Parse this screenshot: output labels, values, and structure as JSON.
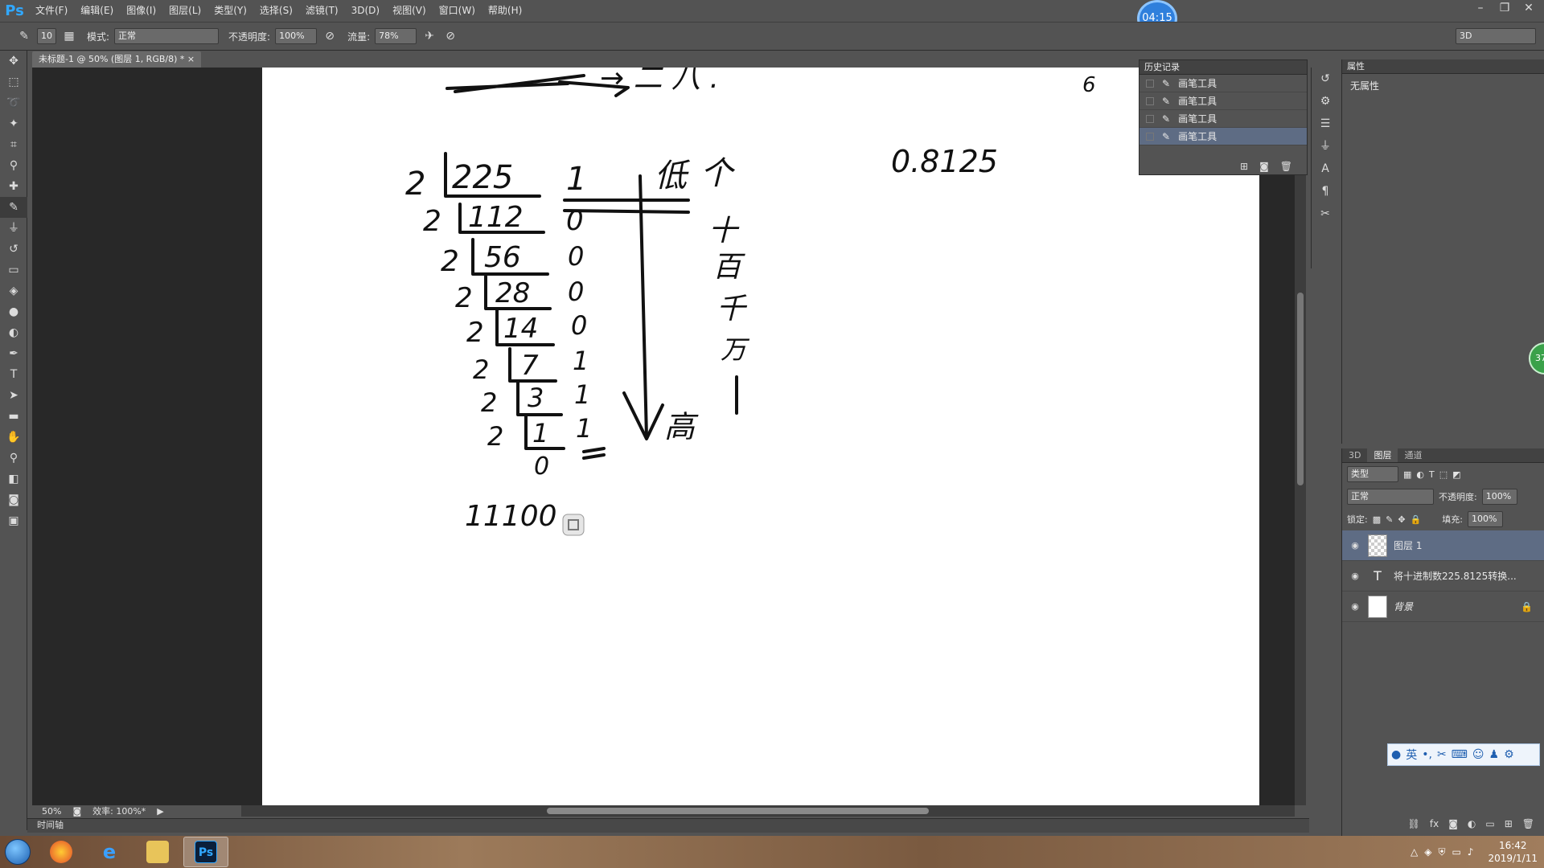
{
  "app": {
    "logo": "Ps",
    "timer": "04:15",
    "badge": "37"
  },
  "menu": [
    "文件(F)",
    "编辑(E)",
    "图像(I)",
    "图层(L)",
    "类型(Y)",
    "选择(S)",
    "滤镜(T)",
    "3D(D)",
    "视图(V)",
    "窗口(W)",
    "帮助(H)"
  ],
  "options": {
    "brush_size": "10",
    "mode_label": "模式:",
    "mode_value": "正常",
    "opacity_label": "不透明度:",
    "opacity_value": "100%",
    "flow_label": "流量:",
    "flow_value": "78%",
    "workspace": "3D"
  },
  "document": {
    "tab": "未标题-1 @ 50% (图层 1, RGB/8) *",
    "zoom": "50%",
    "efficiency": "效率: 100%*"
  },
  "timeline_label": "时间轴",
  "history": {
    "title": "历史记录",
    "items": [
      "画笔工具",
      "画笔工具",
      "画笔工具",
      "画笔工具"
    ]
  },
  "properties": {
    "title": "属性",
    "body": "无属性"
  },
  "layers_panel": {
    "tabs": [
      "3D",
      "图层",
      "通道"
    ],
    "filter": "类型",
    "blend": "正常",
    "opacity_label": "不透明度:",
    "opacity": "100%",
    "lock_label": "锁定:",
    "fill_label": "填充:",
    "fill": "100%",
    "layers": [
      {
        "name": "图层 1",
        "type": "raster"
      },
      {
        "name": "将十进制数225.8125转换...",
        "type": "text"
      },
      {
        "name": "背景",
        "type": "background"
      }
    ]
  },
  "canvas": {
    "handwriting": {
      "top_partial": "→ 二 八 .",
      "dividends": [
        "225",
        "112",
        "56",
        "28",
        "14",
        "7",
        "3",
        "1",
        "0"
      ],
      "divisor": "2",
      "remainders": [
        "1",
        "0",
        "0",
        "0",
        "0",
        "1",
        "1",
        "1"
      ],
      "header_low": "低",
      "header_high": "高",
      "place_values": [
        "个",
        "十",
        "百",
        "千",
        "万"
      ],
      "fraction": "0.8125",
      "result_partial": "11100",
      "corner_mark": "6"
    }
  },
  "ime": {
    "lang": "英"
  },
  "taskbar": {
    "time": "16:42",
    "date": "2019/1/11"
  }
}
